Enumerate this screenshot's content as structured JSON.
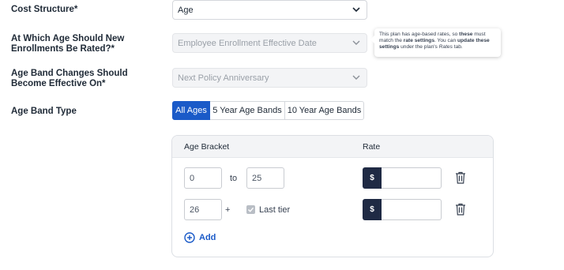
{
  "form": {
    "cost_structure": {
      "label": "Cost Structure*",
      "value": "Age"
    },
    "enrollment_age": {
      "label": "At Which Age Should New Enrollments Be Rated?*",
      "placeholder": "Employee Enrollment Effective Date"
    },
    "age_band_changes": {
      "label": "Age Band Changes Should Become Effective On*",
      "placeholder": "Next Policy Anniversary"
    },
    "age_band_type": {
      "label": "Age Band Type",
      "options": [
        "All Ages",
        "5 Year Age Bands",
        "10 Year Age Bands"
      ],
      "selected": "All Ages"
    }
  },
  "tooltip": {
    "p1": "This plan has age-based rates, so ",
    "b1": "these",
    "p2": " must match the ",
    "b2": "rate settings",
    "p3": ". You can ",
    "b3": "update these settings",
    "p4": " under the plan's ",
    "i1": "Rates",
    "p5": " tab."
  },
  "brackets": {
    "headers": {
      "age_bracket": "Age Bracket",
      "rate": "Rate"
    },
    "rows": [
      {
        "from": "0",
        "to_label": "to",
        "to": "25",
        "currency": "$",
        "rate": ""
      },
      {
        "from": "26",
        "plus": "+",
        "last_tier_label": "Last tier",
        "last_tier_checked": true,
        "currency": "$",
        "rate": ""
      }
    ],
    "add_label": "Add"
  },
  "icons": [
    "chevron-down-icon",
    "trash-icon",
    "checkmark-icon",
    "plus-circle-icon"
  ],
  "colors": {
    "accent": "#1a5ac8",
    "dark": "#1f2a44",
    "disabled_bg": "#f3f4f6"
  }
}
